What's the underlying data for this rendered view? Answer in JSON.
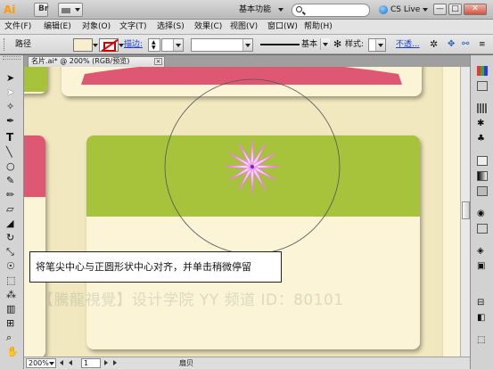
{
  "app": {
    "logo": "Ai",
    "workspace": "基本功能",
    "search_placeholder": "",
    "cs_live": "CS Live",
    "window_buttons": [
      "—",
      "□",
      "✕"
    ]
  },
  "menu": [
    "文件(F)",
    "编辑(E)",
    "对象(O)",
    "文字(T)",
    "选择(S)",
    "效果(C)",
    "视图(V)",
    "窗口(W)",
    "帮助(H)"
  ],
  "control_bar": {
    "object_type": "路径",
    "stroke_label": "描边:",
    "stroke_profile": "基本",
    "style_label": "样式:",
    "opacity_label": "不透..."
  },
  "document": {
    "tab_title": "名片.ai* @ 200% (RGB/预览)",
    "close": "×"
  },
  "status": {
    "zoom": "200%",
    "page": "1",
    "text": "扇贝"
  },
  "caption": {
    "text": "将笔尖中心与正圆形状中心对齐，并单击稍微停留"
  },
  "watermark": "【騰龍視覺】设计学院  YY 频道 ID：80101",
  "colors": {
    "canvas_bg": "#f1e8bf",
    "card_bg": "#fbf4d6",
    "green": "#a7c23b",
    "pink": "#de5874",
    "star_stroke": "#ee82ee"
  },
  "tools": [
    "selection-tool",
    "direct-selection-tool",
    "magic-wand-tool",
    "lasso-tool",
    "pen-tool",
    "type-tool",
    "line-tool",
    "ellipse-tool",
    "paintbrush-tool",
    "pencil-tool",
    "blob-brush-tool",
    "eraser-tool",
    "rotate-tool",
    "scale-tool",
    "warp-tool",
    "free-transform-tool",
    "symbol-sprayer-tool",
    "graph-tool",
    "mesh-tool",
    "gradient-tool",
    "eyedropper-tool",
    "blend-tool",
    "hand-tool",
    "zoom-tool"
  ]
}
